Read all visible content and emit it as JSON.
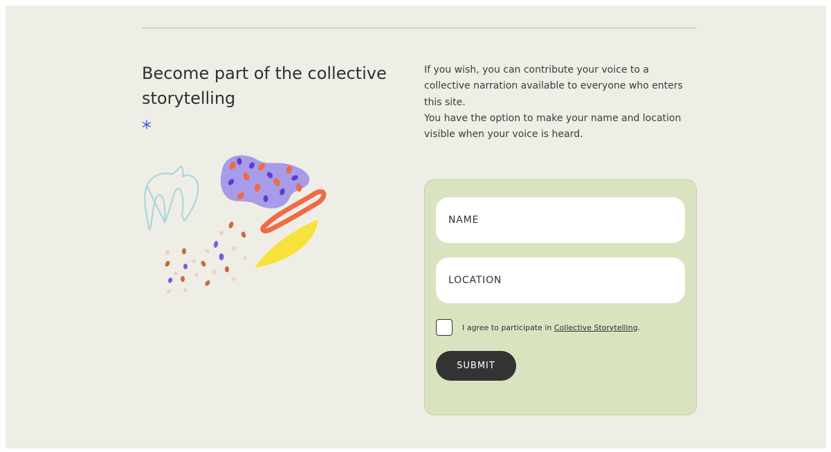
{
  "heading": "Become part of the collective storytelling",
  "intro": {
    "line1": "If you wish, you can contribute your voice to a collective narration available to everyone who enters this site.",
    "line2": "You have the option to make your name and location visible when your voice is heard."
  },
  "form": {
    "name_placeholder": "NAME",
    "location_placeholder": "LOCATION",
    "consent_prefix": "I agree to participate in ",
    "consent_link": "Collective Storytelling",
    "consent_suffix": ".",
    "consent_checked": false,
    "submit_label": "SUBMIT"
  },
  "colors": {
    "page_background": "#efeee6",
    "form_card": "#dae3c0",
    "submit_button": "#333333",
    "asterisk": "#3b5bdb"
  },
  "icons": {
    "asterisk": "asterisk-icon",
    "illustration": "abstract-shapes-illustration"
  }
}
